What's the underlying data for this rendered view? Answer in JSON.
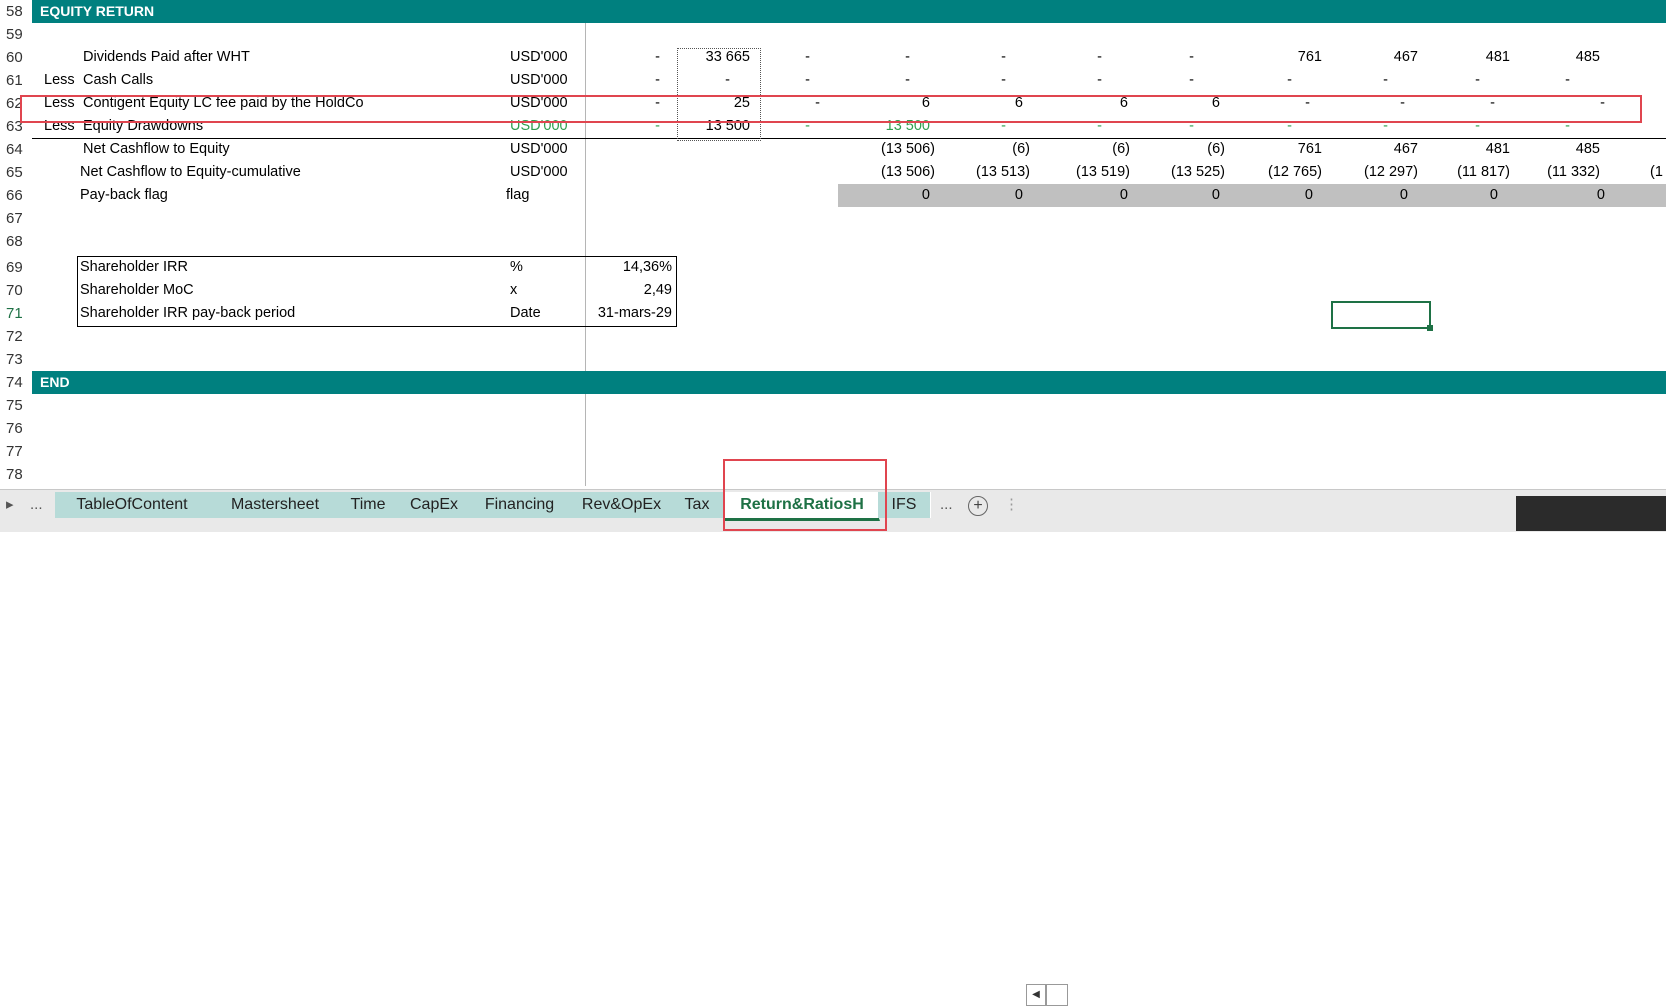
{
  "sheet": {
    "section_equity_return": "EQUITY RETURN",
    "section_end": "END",
    "row_numbers": [
      "58",
      "59",
      "60",
      "61",
      "62",
      "63",
      "64",
      "65",
      "66",
      "67",
      "68",
      "69",
      "70",
      "71",
      "72",
      "73",
      "74",
      "75",
      "76",
      "77",
      "78"
    ],
    "rows": {
      "dividends": {
        "prefix": "",
        "label": "Dividends Paid after WHT",
        "unit": "USD'000",
        "values": [
          "-",
          "33 665",
          "-",
          "-",
          "-",
          "-",
          "-",
          "761",
          "467",
          "481",
          "485"
        ]
      },
      "cash_calls": {
        "prefix": "Less",
        "label": "Cash Calls",
        "unit": "USD'000",
        "values": [
          "-",
          "-",
          "-",
          "-",
          "-",
          "-",
          "-",
          "-",
          "-",
          "-",
          "-"
        ]
      },
      "contingent": {
        "prefix": "Less",
        "label": "Contigent Equity LC fee paid by the HoldCo",
        "unit": "USD'000",
        "values": [
          "-",
          "25",
          "-",
          "6",
          "6",
          "6",
          "6",
          "-",
          "-",
          "-",
          "-"
        ]
      },
      "drawdowns": {
        "prefix": "Less",
        "label": "Equity  Drawdowns",
        "unit": "USD'000",
        "values": [
          "-",
          "13 500",
          "-",
          "13 500",
          "-",
          "-",
          "-",
          "-",
          "-",
          "-",
          "-"
        ]
      },
      "net_cf": {
        "label": "Net Cashflow to Equity",
        "unit": "USD'000",
        "values": [
          "(13 506)",
          "(6)",
          "(6)",
          "(6)",
          "761",
          "467",
          "481",
          "485"
        ]
      },
      "net_cf_cum": {
        "label": "Net Cashflow to Equity-cumulative",
        "unit": "USD'000",
        "values": [
          "(13 506)",
          "(13 513)",
          "(13 519)",
          "(13 525)",
          "(12 765)",
          "(12 297)",
          "(11 817)",
          "(11 332)",
          "(1"
        ]
      },
      "payback": {
        "label": "Pay-back flag",
        "unit": "flag",
        "values": [
          "0",
          "0",
          "0",
          "0",
          "0",
          "0",
          "0",
          "0"
        ]
      }
    },
    "kpis": [
      {
        "label": "Shareholder IRR",
        "unit": "%",
        "value": "14,36%"
      },
      {
        "label": " Shareholder MoC",
        "unit": "x",
        "value": "2,49"
      },
      {
        "label": "Shareholder IRR pay-back period",
        "unit": "Date",
        "value": "31-mars-29"
      }
    ]
  },
  "tabs": {
    "left_ellipsis": "...",
    "items": [
      "TableOfContent",
      "Mastersheet",
      "Time",
      "CapEx",
      "Financing",
      "Rev&OpEx",
      "Tax",
      "Return&RatiosH",
      "IFS"
    ],
    "active": "Return&RatiosH",
    "right_ellipsis": "...",
    "add_symbol": "+"
  },
  "colors": {
    "band": "#00807f",
    "highlight_red": "#e0454f",
    "active_green": "#1e7145",
    "tab_teal": "#b7dbd8",
    "green_text": "#2f9f4f"
  }
}
